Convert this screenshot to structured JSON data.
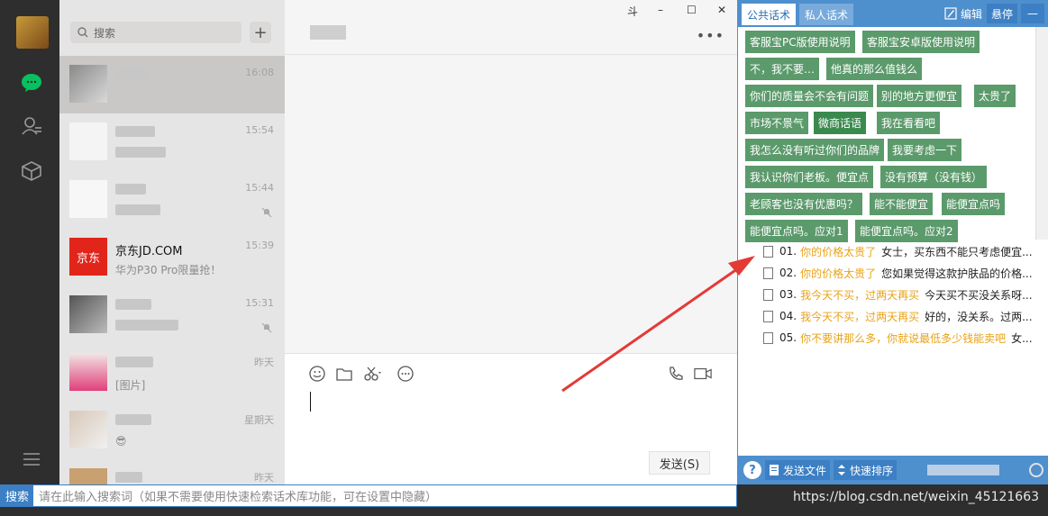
{
  "search": {
    "placeholder": "搜索"
  },
  "chats": [
    {
      "name": "",
      "msg": "",
      "time": "16:08",
      "active": true
    },
    {
      "name": "",
      "msg": "",
      "time": "15:54"
    },
    {
      "name": "",
      "msg": "",
      "time": "15:44",
      "muted": true
    },
    {
      "name": "京东JD.COM",
      "msg": "华为P30 Pro限量抢！",
      "time": "15:39"
    },
    {
      "name": "",
      "msg": "",
      "time": "15:31",
      "muted": true
    },
    {
      "name": "",
      "msg": "[图片]",
      "time": "昨天"
    },
    {
      "name": "",
      "msg": "😎",
      "time": "星期天"
    },
    {
      "name": "",
      "msg": "",
      "time": "昨天"
    }
  ],
  "window": {
    "pin": "⽃",
    "minimize": "–",
    "maximize": "☐",
    "close": "✕"
  },
  "composer": {
    "send_label": "发送(S)"
  },
  "bottom_bar": {
    "label": "搜索",
    "placeholder": "请在此输入搜索词（如果不需要使用快速检索话术库功能，可在设置中隐藏）"
  },
  "panel": {
    "tabs": {
      "public": "公共话术",
      "private": "私人话术"
    },
    "edit": "编辑",
    "float": "悬停",
    "collapse": "—",
    "buttons": [
      [
        "客服宝PC版使用说明",
        "客服宝安卓版使用说明"
      ],
      [
        "不，我不要…",
        "他真的那么值钱么"
      ],
      [
        "你们的质量会不会有问题",
        "别的地方更便宜",
        "太贵了"
      ],
      [
        "市场不景气",
        "微商话语",
        "我在看看吧"
      ],
      [
        "我怎么没有听过你们的品牌",
        "我要考虑一下"
      ],
      [
        "我认识你们老板。便宜点",
        "没有预算（没有钱）"
      ],
      [
        "老顾客也没有优惠吗？",
        "能不能便宜",
        "能便宜点吗"
      ],
      [
        "能便宜点吗。应对1",
        "能便宜点吗。应对2"
      ]
    ],
    "scripts": [
      {
        "num": "01.",
        "q": "你的价格太贵了",
        "a": "女士，买东西不能只考虑便宜..."
      },
      {
        "num": "02.",
        "q": "你的价格太贵了",
        "a": "您如果觉得这款护肤品的价格..."
      },
      {
        "num": "03.",
        "q": "我今天不买，过两天再买",
        "a": "今天买不买没关系呀..."
      },
      {
        "num": "04.",
        "q": "我今天不买，过两天再买",
        "a": "好的，没关系。过两..."
      },
      {
        "num": "05.",
        "q": "你不要讲那么多，你就说最低多少钱能卖吧",
        "a": "女..."
      }
    ],
    "footer": {
      "send_file": "发送文件",
      "quick_sort": "快速排序",
      "help": "?"
    }
  },
  "watermark": "https://blog.csdn.net/weixin_45121663"
}
